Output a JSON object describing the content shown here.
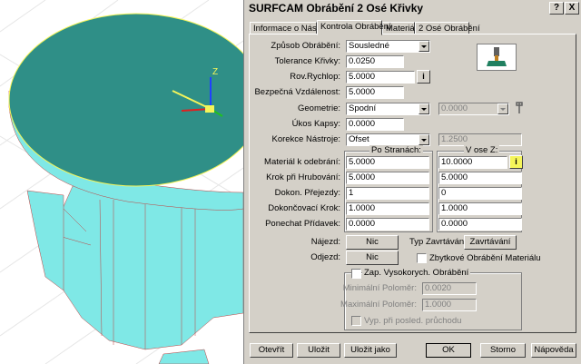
{
  "dialog": {
    "title": "SURFCAM Obrábění 2 Osé Křivky",
    "help_btn": "?",
    "close_btn": "X"
  },
  "tabs": [
    {
      "label": "Informace o Nástroji"
    },
    {
      "label": "Kontrola Obrábění",
      "active": true
    },
    {
      "label": "Materiál"
    },
    {
      "label": "2 Osé Obrábění"
    }
  ],
  "form": {
    "zpusob_label": "Způsob Obrábění:",
    "zpusob_value": "Sousledné",
    "tolerance_label": "Tolerance Křivky:",
    "tolerance_value": "0.0250",
    "rovina_label": "Rov.Rychlop:",
    "rovina_value": "5.0000",
    "rovina_btn": "i",
    "bezpecna_label": "Bezpečná Vzdálenost:",
    "bezpecna_value": "5.0000",
    "geometrie_label": "Geometrie:",
    "geometrie_value": "Spodní",
    "geometrie_disabled_value": "0.0000",
    "ukos_label": "Úkos Kapsy:",
    "ukos_value": "0.0000",
    "korekce_label": "Korekce Nástroje:",
    "korekce_value": "Ofset",
    "korekce_disabled_value": "1.2500"
  },
  "columns": {
    "po_stranach": "Po Stranách:",
    "v_ose_z": "V ose Z:"
  },
  "grid": {
    "material_label": "Materiál k odebrání:",
    "material_side": "5.0000",
    "material_z": "10.0000",
    "material_z_btn": "i",
    "krok_label": "Krok při Hrubování:",
    "krok_side": "5.0000",
    "krok_z": "5.0000",
    "dokon_label": "Dokon. Přejezdy:",
    "dokon_side": "1",
    "dokon_z": "0",
    "dokoncovaci_label": "Dokončovací Krok:",
    "dokoncovaci_side": "1.0000",
    "dokoncovaci_z": "1.0000",
    "ponechat_label": "Ponechat Přídavek:",
    "ponechat_side": "0.0000",
    "ponechat_z": "0.0000"
  },
  "approach": {
    "najezd_label": "Nájezd:",
    "najezd_btn": "Nic",
    "odjezd_label": "Odjezd:",
    "odjezd_btn": "Nic",
    "typ_label": "Typ Zavrtávání:",
    "typ_btn": "Zavrtávání",
    "zbytkove_label": "Zbytkové Obrábění Materiálu"
  },
  "hsm": {
    "title": "Zap. Vysokorych. Obrábění",
    "min_label": "Minimální Poloměr:",
    "min_value": "0.0020",
    "max_label": "Maximální Poloměr:",
    "max_value": "1.0000",
    "vyp_label": "Vyp. při posled. průchodu"
  },
  "buttons": {
    "otevrit": "Otevřít",
    "ulozit": "Uložit",
    "ulozit_jako": "Uložit jako",
    "ok": "OK",
    "storno": "Storno",
    "napoveda": "Nápověda"
  },
  "axis_labels": {
    "z": "Z"
  },
  "colors": {
    "part_top": "#2f8f87",
    "part_side": "#7fe8e6",
    "dialog_bg": "#d4d0c8"
  }
}
